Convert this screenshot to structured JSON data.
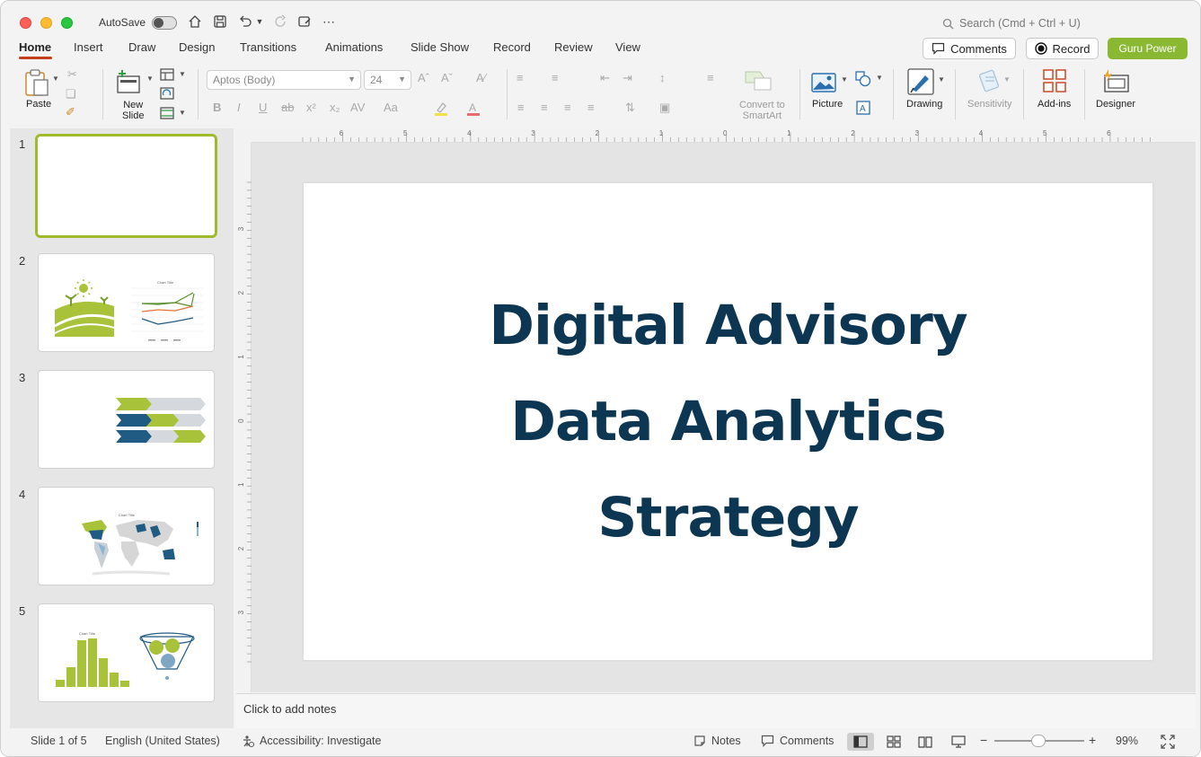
{
  "titlebar": {
    "autosave_label": "AutoSave",
    "search_placeholder": "Search (Cmd + Ctrl + U)"
  },
  "tabs": [
    "Home",
    "Insert",
    "Draw",
    "Design",
    "Transitions",
    "Animations",
    "Slide Show",
    "Record",
    "Review",
    "View"
  ],
  "actions": {
    "comments": "Comments",
    "record": "Record",
    "guru": "Guru Power"
  },
  "ribbon": {
    "paste": "Paste",
    "new_slide_1": "New",
    "new_slide_2": "Slide",
    "font_name": "Aptos (Body)",
    "font_size": "24",
    "convert_1": "Convert to",
    "convert_2": "SmartArt",
    "picture": "Picture",
    "drawing": "Drawing",
    "sensitivity": "Sensitivity",
    "addins": "Add-ins",
    "designer": "Designer"
  },
  "ruler": {
    "h_labels": [
      "6",
      "5",
      "4",
      "3",
      "2",
      "1",
      "0",
      "1",
      "2",
      "3",
      "4",
      "5",
      "6"
    ],
    "v_labels": [
      "3",
      "2",
      "1",
      "0",
      "1",
      "2",
      "3"
    ]
  },
  "thumbnails": [
    {
      "num": "1"
    },
    {
      "num": "2",
      "chart_title": "Chart Title"
    },
    {
      "num": "3"
    },
    {
      "num": "4",
      "chart_title": "Chart Title"
    },
    {
      "num": "5",
      "chart_title": "Chart Title"
    }
  ],
  "slide": {
    "title_lines": [
      "Digital Advisory",
      "Data Analytics",
      "Strategy"
    ]
  },
  "notes_placeholder": "Click to add notes",
  "status": {
    "slide_info": "Slide 1 of 5",
    "language": "English (United States)",
    "accessibility": "Accessibility: Investigate",
    "notes": "Notes",
    "comments": "Comments",
    "zoom": "99%"
  },
  "colors": {
    "accent_red": "#c43e1c",
    "guru_green": "#8ab833",
    "title_navy": "#0c3652",
    "thumb_green": "#9fbb2c",
    "thumb_blue": "#1f5b82"
  }
}
